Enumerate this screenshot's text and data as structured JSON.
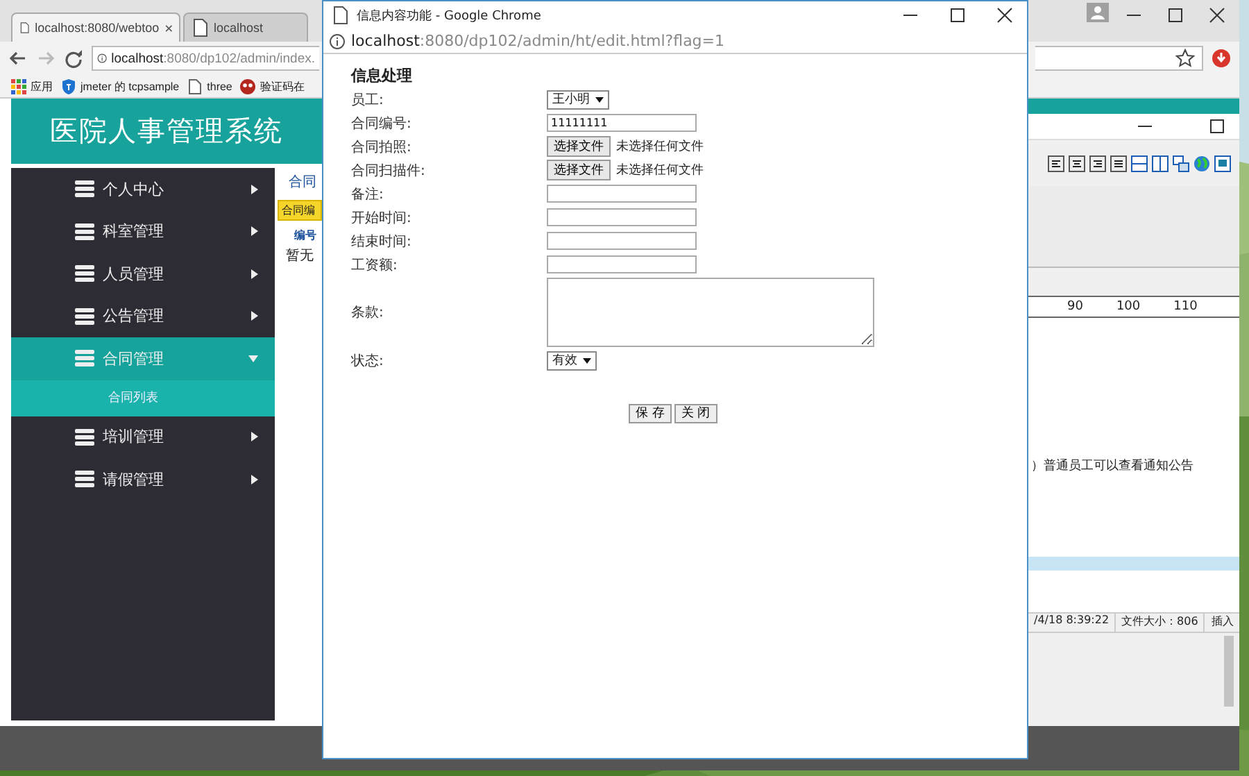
{
  "back_browser": {
    "tabs": [
      {
        "title": "localhost:8080/webtoo",
        "selected": true
      },
      {
        "title": "localhost",
        "selected": false
      }
    ],
    "address": {
      "host": "localhost",
      "path": ":8080/dp102/admin/index."
    },
    "bookmarks": [
      {
        "label": "应用",
        "kind": "apps"
      },
      {
        "label": "jmeter 的 tcpsample",
        "kind": "shield"
      },
      {
        "label": "three",
        "kind": "page"
      },
      {
        "label": "验证码在",
        "kind": "logo"
      }
    ],
    "app": {
      "title": "医院人事管理系统",
      "sidebar": [
        {
          "label": "个人中心",
          "expanded": false
        },
        {
          "label": "科室管理",
          "expanded": false
        },
        {
          "label": "人员管理",
          "expanded": false
        },
        {
          "label": "公告管理",
          "expanded": false
        },
        {
          "label": "合同管理",
          "expanded": true,
          "children": [
            {
              "label": "合同列表"
            }
          ]
        },
        {
          "label": "培训管理",
          "expanded": false
        },
        {
          "label": "请假管理",
          "expanded": false
        }
      ],
      "content": {
        "breadcrumb": "合同",
        "tab": "合同编",
        "column": "编号",
        "empty": "暂无"
      }
    }
  },
  "editor": {
    "ruler": [
      "90",
      "100",
      "110"
    ],
    "text": "）普通员工可以查看通知公告",
    "status": [
      "/4/18 8:39:22",
      "文件大小：806",
      "插入"
    ]
  },
  "popup": {
    "title": "信息内容功能 - Google Chrome",
    "url": {
      "host": "localhost",
      "rest": ":8080/dp102/admin/ht/edit.html?flag=1"
    },
    "heading": "信息处理",
    "fields": [
      {
        "label": "员工:",
        "kind": "select",
        "value": "王小明"
      },
      {
        "label": "合同编号:",
        "kind": "text",
        "value": "11111111"
      },
      {
        "label": "合同拍照:",
        "kind": "file",
        "button": "选择文件",
        "note": "未选择任何文件"
      },
      {
        "label": "合同扫描件:",
        "kind": "file",
        "button": "选择文件",
        "note": "未选择任何文件"
      },
      {
        "label": "备注:",
        "kind": "text"
      },
      {
        "label": "开始时间:",
        "kind": "text"
      },
      {
        "label": "结束时间:",
        "kind": "text"
      },
      {
        "label": "工资额:",
        "kind": "text"
      },
      {
        "label": "条款:",
        "kind": "textarea"
      },
      {
        "label": "状态:",
        "kind": "select",
        "value": "有效"
      }
    ],
    "buttons": [
      "保 存",
      "关 闭"
    ]
  }
}
